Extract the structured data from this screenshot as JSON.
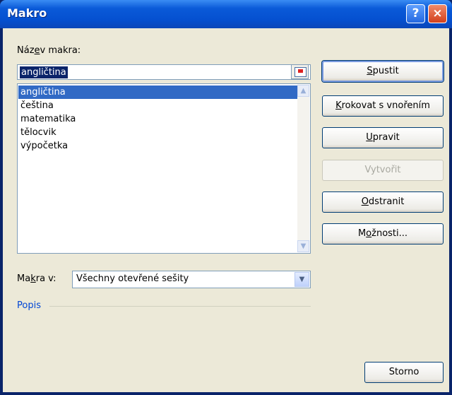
{
  "window": {
    "title": "Makro",
    "help_glyph": "?",
    "close_glyph": "×"
  },
  "macro_name": {
    "label_pre": "Náz",
    "label_key": "e",
    "label_post": "v makra:",
    "value": "angličtina"
  },
  "macro_list": {
    "items": [
      "angličtina",
      "čeština",
      "matematika",
      "tělocvik",
      "výpočetka"
    ],
    "selected_index": 0,
    "scroll_up": "▲",
    "scroll_down": "▼"
  },
  "buttons": {
    "run": {
      "key": "S",
      "rest": "pustit"
    },
    "step_into": {
      "key": "K",
      "rest": "rokovat s vnořením"
    },
    "edit": {
      "key": "U",
      "rest": "pravit"
    },
    "create": {
      "label": "Vytvořit",
      "enabled": false
    },
    "delete": {
      "key": "O",
      "rest": "dstranit"
    },
    "options": {
      "pre": "M",
      "key": "o",
      "rest": "žnosti..."
    }
  },
  "macros_in": {
    "label_pre": "Ma",
    "label_key": "k",
    "label_post": "ra v:",
    "value": "Všechny otevřené sešity",
    "arrow": "▼"
  },
  "description": {
    "label": "Popis"
  },
  "cancel": {
    "label": "Storno"
  }
}
